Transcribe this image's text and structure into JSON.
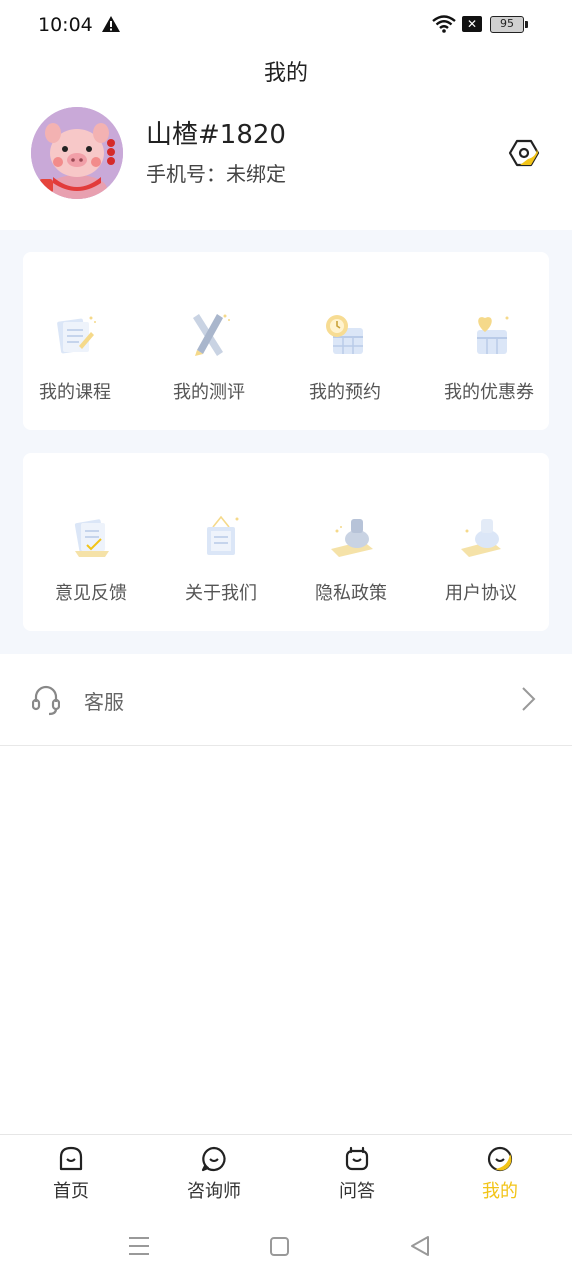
{
  "status_bar": {
    "time": "10:04",
    "battery": "95"
  },
  "header": {
    "title": "我的"
  },
  "profile": {
    "username": "山楂#1820",
    "phone_text": "手机号：未绑定"
  },
  "menu_card_1": [
    {
      "label": "我的课程",
      "icon": "course-icon"
    },
    {
      "label": "我的测评",
      "icon": "assessment-icon"
    },
    {
      "label": "我的预约",
      "icon": "appointment-icon"
    },
    {
      "label": "我的优惠券",
      "icon": "coupon-icon"
    }
  ],
  "menu_card_2": [
    {
      "label": "意见反馈",
      "icon": "feedback-icon"
    },
    {
      "label": "关于我们",
      "icon": "about-icon"
    },
    {
      "label": "隐私政策",
      "icon": "privacy-icon"
    },
    {
      "label": "用户协议",
      "icon": "agreement-icon"
    }
  ],
  "service": {
    "label": "客服"
  },
  "bottom_nav": [
    {
      "label": "首页",
      "active": false
    },
    {
      "label": "咨询师",
      "active": false
    },
    {
      "label": "问答",
      "active": false
    },
    {
      "label": "我的",
      "active": true
    }
  ],
  "colors": {
    "accent": "#f2c418",
    "background_panel": "#f4f7fc"
  }
}
